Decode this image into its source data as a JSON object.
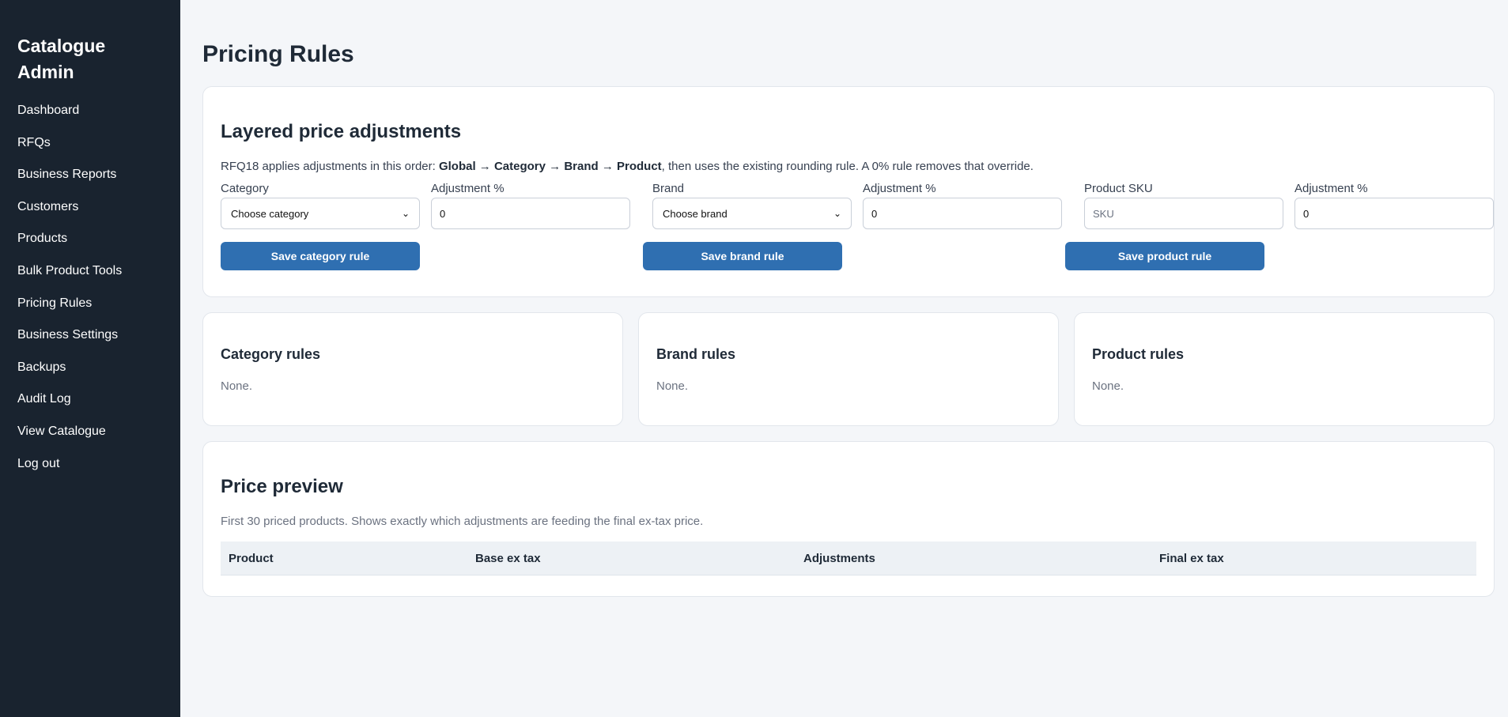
{
  "sidebar": {
    "brand": "Catalogue Admin",
    "items": [
      {
        "label": "Dashboard"
      },
      {
        "label": "RFQs"
      },
      {
        "label": "Business Reports"
      },
      {
        "label": "Customers"
      },
      {
        "label": "Products"
      },
      {
        "label": "Bulk Product Tools"
      },
      {
        "label": "Pricing Rules"
      },
      {
        "label": "Business Settings"
      },
      {
        "label": "Backups"
      },
      {
        "label": "Audit Log"
      },
      {
        "label": "View Catalogue"
      },
      {
        "label": "Log out"
      }
    ]
  },
  "page": {
    "title": "Pricing Rules"
  },
  "adjustments": {
    "title": "Layered price adjustments",
    "desc_prefix": "RFQ18 applies adjustments in this order: ",
    "desc_order": "Global → Category → Brand → Product",
    "desc_suffix": ", then uses the existing rounding rule. A 0% rule removes that override.",
    "category_label": "Category",
    "category_selected": "Choose category",
    "category_adj_label": "Adjustment %",
    "category_adj_value": "0",
    "brand_label": "Brand",
    "brand_selected": "Choose brand",
    "brand_adj_label": "Adjustment %",
    "brand_adj_value": "0",
    "sku_label": "Product SKU",
    "sku_placeholder": "SKU",
    "product_adj_label": "Adjustment %",
    "product_adj_value": "0",
    "save_category": "Save category rule",
    "save_brand": "Save brand rule",
    "save_product": "Save product rule"
  },
  "rules": {
    "category": {
      "title": "Category rules",
      "empty": "None."
    },
    "brand": {
      "title": "Brand rules",
      "empty": "None."
    },
    "product": {
      "title": "Product rules",
      "empty": "None."
    }
  },
  "preview": {
    "title": "Price preview",
    "desc": "First 30 priced products. Shows exactly which adjustments are feeding the final ex-tax price.",
    "columns": [
      "Product",
      "Base ex tax",
      "Adjustments",
      "Final ex tax"
    ]
  },
  "colors": {
    "sidebar_bg": "#19232f",
    "accent": "#2f6fb1",
    "page_bg": "#f4f6f9"
  }
}
